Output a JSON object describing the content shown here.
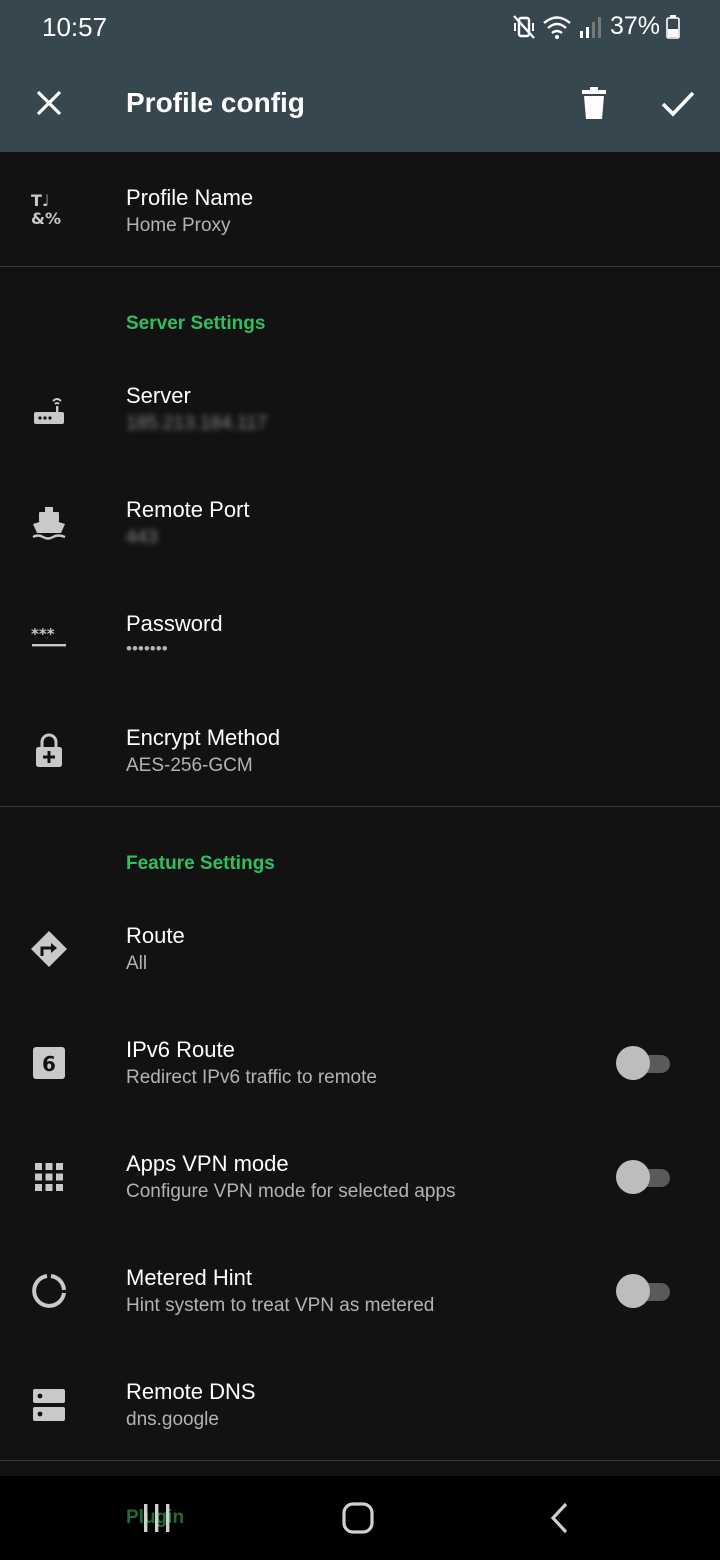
{
  "status_bar": {
    "time": "10:57",
    "battery_text": "37%",
    "icons": [
      "vibrate-mute-icon",
      "wifi-icon",
      "signal-icon",
      "battery-icon"
    ]
  },
  "app_bar": {
    "title": "Profile config",
    "icons": [
      "close-icon",
      "delete-icon",
      "check-icon"
    ]
  },
  "profile": {
    "title": "Profile Name",
    "value": "Home Proxy",
    "icon": "text-fields-icon"
  },
  "server_settings": {
    "header": "Server Settings",
    "items": [
      {
        "title": "Server",
        "value": "185.213.184.117",
        "icon": "router-icon"
      },
      {
        "title": "Remote Port",
        "value": "443",
        "icon": "ship-icon"
      },
      {
        "title": "Password",
        "value": "•••••••",
        "icon": "password-icon"
      },
      {
        "title": "Encrypt Method",
        "value": "AES-256-GCM",
        "icon": "lock-icon"
      }
    ]
  },
  "feature_settings": {
    "header": "Feature Settings",
    "items": [
      {
        "title": "Route",
        "value": "All",
        "icon": "directions-icon"
      },
      {
        "title": "IPv6 Route",
        "value": "Redirect IPv6 traffic to remote",
        "icon": "six-icon",
        "toggle": false
      },
      {
        "title": "Apps VPN mode",
        "value": "Configure VPN mode for selected apps",
        "icon": "apps-grid-icon",
        "toggle": false
      },
      {
        "title": "Metered Hint",
        "value": "Hint system to treat VPN as metered",
        "icon": "data-usage-icon",
        "toggle": false
      },
      {
        "title": "Remote DNS",
        "value": "dns.google",
        "icon": "dns-icon"
      }
    ]
  },
  "next_section": {
    "header": "Plugin"
  },
  "colors": {
    "app_bar": "#37474f",
    "background": "#121212",
    "accent": "#2fbf5f"
  }
}
